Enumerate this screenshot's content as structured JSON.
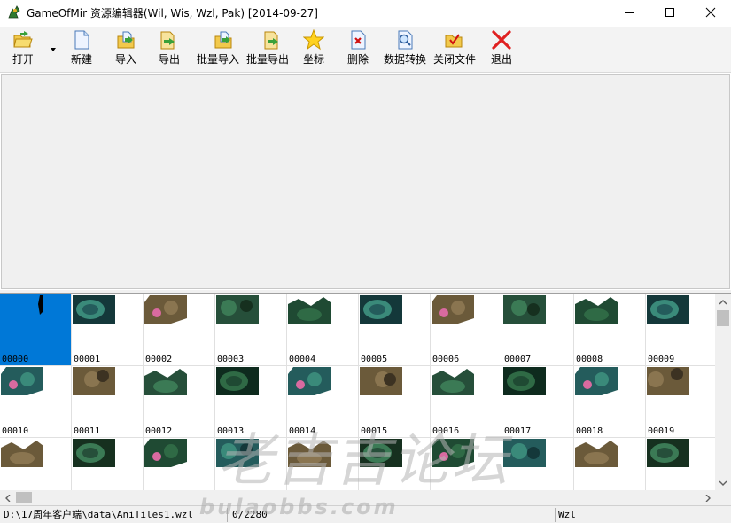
{
  "window": {
    "title": "GameOfMir 资源编辑器(Wil, Wis, Wzl, Pak) [2014-09-27]"
  },
  "toolbar": {
    "buttons": [
      {
        "id": "open",
        "label": "打开",
        "icon": "folder-open-icon"
      },
      {
        "id": "new",
        "label": "新建",
        "icon": "new-document-icon"
      },
      {
        "id": "import",
        "label": "导入",
        "icon": "import-icon"
      },
      {
        "id": "export",
        "label": "导出",
        "icon": "export-icon"
      },
      {
        "id": "batch-import",
        "label": "批量导入",
        "icon": "batch-import-icon"
      },
      {
        "id": "batch-export",
        "label": "批量导出",
        "icon": "batch-export-icon"
      },
      {
        "id": "coordinates",
        "label": "坐标",
        "icon": "star-icon"
      },
      {
        "id": "delete",
        "label": "删除",
        "icon": "delete-document-icon"
      },
      {
        "id": "convert",
        "label": "数据转换",
        "icon": "search-document-icon"
      },
      {
        "id": "close-file",
        "label": "关闭文件",
        "icon": "close-file-icon"
      },
      {
        "id": "exit",
        "label": "退出",
        "icon": "exit-x-icon"
      }
    ]
  },
  "grid": {
    "selected_index": 0,
    "rows": [
      [
        "00000",
        "00001",
        "00002",
        "00003",
        "00004",
        "00005",
        "00006",
        "00007",
        "00008",
        "00009"
      ],
      [
        "00010",
        "00011",
        "00012",
        "00013",
        "00014",
        "00015",
        "00016",
        "00017",
        "00018",
        "00019"
      ],
      [
        "",
        "",
        "",
        "",
        "",
        "",
        "",
        "",
        "",
        ""
      ]
    ]
  },
  "statusbar": {
    "path": "D:\\17周年客户端\\data\\AniTiles1.wzl",
    "position": "0/2280",
    "format": "Wzl"
  },
  "watermark": {
    "big": "老吉吉论坛",
    "small": "bulaobbs.com"
  },
  "colors": {
    "selection": "#0078d7",
    "toolbar_bg": "#f3f3f3",
    "panel_bg": "#f0f0f0"
  }
}
